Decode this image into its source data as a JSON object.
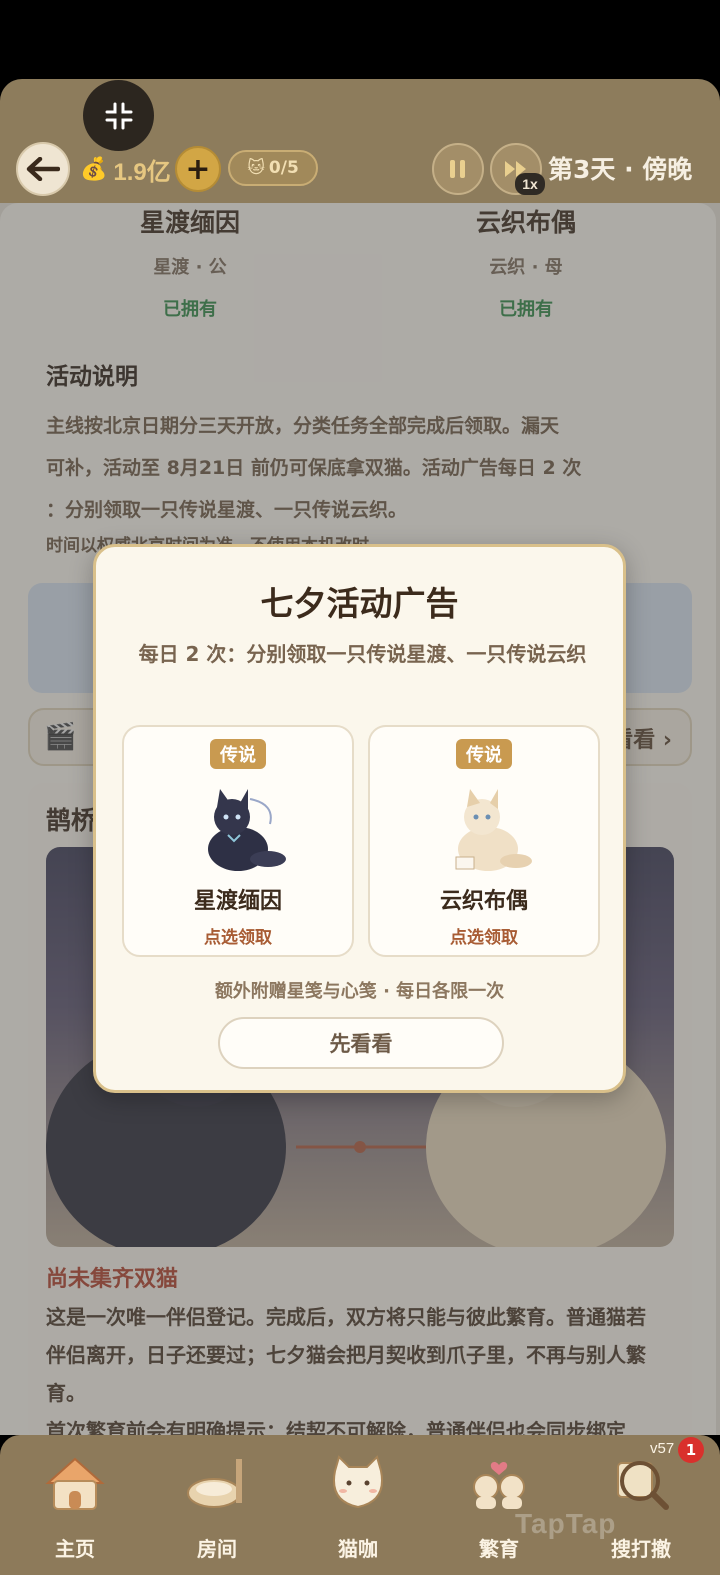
{
  "header": {
    "coins": "1.9亿",
    "plus_label": "+",
    "cat_count": "0/5",
    "speed": "1x",
    "day_label": "第3天 · 傍晚"
  },
  "cats_owned": [
    {
      "name": "星渡缅因",
      "sub": "星渡 · 公",
      "status": "已拥有"
    },
    {
      "name": "云织布偶",
      "sub": "云织 · 母",
      "status": "已拥有"
    }
  ],
  "activity": {
    "title": "活动说明",
    "line1": "主线按北京日期分三天开放，分类任务全部完成后领取。漏天",
    "line2": "可补，活动至 8月21日 前仍可保底拿双猫。活动广告每日 2 次",
    "line3": "：分别领取一只传说星渡、一只传说云织。",
    "line4": "时间以权威北京时间为准，不使用本机改时。"
  },
  "ad_row": {
    "more_label": "看看 ›"
  },
  "magpie": {
    "title": "鹊桥",
    "warn": "尚未集齐双猫",
    "desc1": "这是一次唯一伴侣登记。完成后，双方将只能与彼此繁育。普通猫若",
    "desc2": "伴侣离开，日子还要过；七夕猫会把月契收到爪子里，不再与别人繁",
    "desc3": "育。",
    "desc4": "首次繁育前会有明确提示：结契不可解除，普通伴侣也会同步绑定"
  },
  "modal": {
    "title": "七夕活动广告",
    "subtitle": "每日 2 次：分别领取一只传说星渡、一只传说云织",
    "choices": [
      {
        "tag": "传说",
        "name": "星渡缅因",
        "action": "点选领取"
      },
      {
        "tag": "传说",
        "name": "云织布偶",
        "action": "点选领取"
      }
    ],
    "bonus": "额外附赠星笺与心笺 · 每日各限一次",
    "later_label": "先看看"
  },
  "nav": {
    "items": [
      {
        "label": "主页",
        "icon": "house-icon"
      },
      {
        "label": "房间",
        "icon": "cat-bed-icon"
      },
      {
        "label": "猫咖",
        "icon": "cat-cup-icon"
      },
      {
        "label": "繁育",
        "icon": "cat-couple-icon"
      },
      {
        "label": "搜打撤",
        "icon": "search-map-icon"
      }
    ],
    "version": "v57",
    "notification_count": "1",
    "watermark": "TapTap"
  },
  "colors": {
    "header_bg": "#8d7c5c",
    "nav_bg": "#8d7a5a",
    "owned_green": "#2f8a45",
    "tag_gold": "#c99a50",
    "warn_red": "#b3412c"
  }
}
